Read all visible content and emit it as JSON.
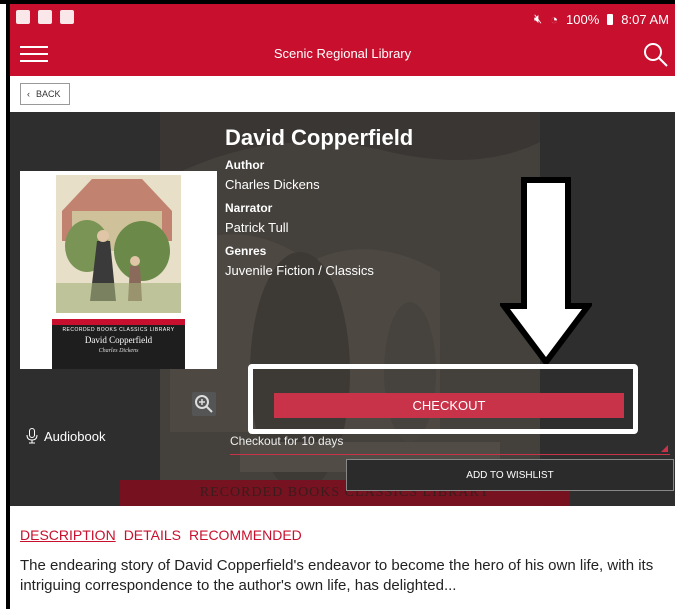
{
  "status_bar": {
    "battery": "100%",
    "time": "8:07 AM"
  },
  "app_bar": {
    "title": "Scenic Regional Library"
  },
  "back": {
    "label": "BACK"
  },
  "book": {
    "title": "David Copperfield",
    "author_label": "Author",
    "author": "Charles Dickens",
    "narrator_label": "Narrator",
    "narrator": "Patrick Tull",
    "genres_label": "Genres",
    "genres": "Juvenile Fiction / Classics",
    "format": "Audiobook",
    "cover": {
      "series": "RECORDED BOOKS CLASSICS LIBRARY",
      "title": "David Copperfield",
      "author": "Charles Dickens"
    },
    "banner_text": "RECORDED BOOKS CLASSICS LIBRARY"
  },
  "actions": {
    "checkout": "CHECKOUT",
    "loan_period": "Checkout for 10 days",
    "wishlist": "ADD TO WISHLIST"
  },
  "tabs": [
    {
      "label": "DESCRIPTION",
      "active": true
    },
    {
      "label": "DETAILS",
      "active": false
    },
    {
      "label": "RECOMMENDED",
      "active": false
    }
  ],
  "description": "The endearing story of David Copperfield's endeavor to become the hero of his own life, with its intriguing correspondence to the author's own life, has delighted...",
  "colors": {
    "brand": "#c8102e",
    "checkout": "#c8334a",
    "hero_bg": "#2b2b2b"
  }
}
